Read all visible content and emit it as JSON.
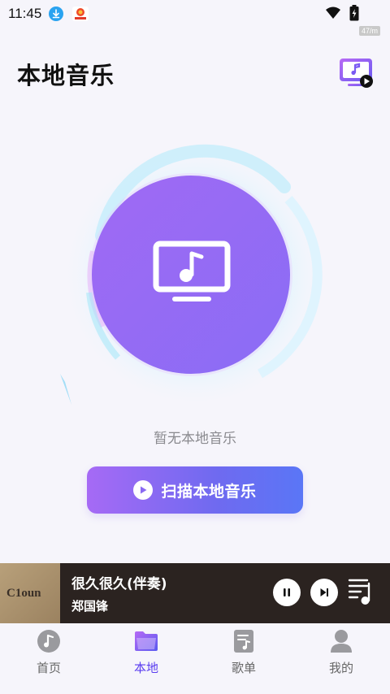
{
  "status_bar": {
    "time": "11:45",
    "speed": "47/m"
  },
  "header": {
    "title": "本地音乐"
  },
  "main": {
    "empty_text": "暂无本地音乐",
    "scan_button_label": "扫描本地音乐"
  },
  "player": {
    "album_art_text": "C1oun",
    "track_title": "很久很久(伴奏)",
    "track_artist": "郑国锋"
  },
  "nav": {
    "items": [
      {
        "label": "首页",
        "icon": "music-disc-icon",
        "active": false
      },
      {
        "label": "本地",
        "icon": "folder-icon",
        "active": true
      },
      {
        "label": "歌单",
        "icon": "playlist-icon",
        "active": false
      },
      {
        "label": "我的",
        "icon": "profile-icon",
        "active": false
      }
    ]
  },
  "colors": {
    "accent": "#5a3df0",
    "button_gradient_start": "#a66af5",
    "button_gradient_end": "#5a76f6",
    "player_bg": "#2b2320",
    "page_bg": "#f6f5fb"
  }
}
